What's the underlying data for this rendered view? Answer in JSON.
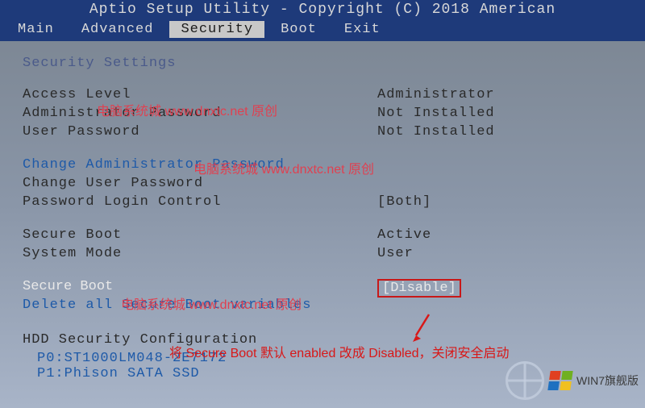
{
  "title": "Aptio Setup Utility - Copyright (C) 2018 American",
  "menu": {
    "items": [
      "Main",
      "Advanced",
      "Security",
      "Boot",
      "Exit"
    ],
    "active": "Security"
  },
  "section_title": "Security Settings",
  "rows": {
    "access_level": {
      "label": "Access Level",
      "value": "Administrator"
    },
    "admin_password": {
      "label": "Administrator Password",
      "value": "Not Installed"
    },
    "user_password": {
      "label": "User Password",
      "value": "Not Installed"
    },
    "change_admin": "Change Administrator Password",
    "change_user": {
      "label": "Change User Password"
    },
    "login_control": {
      "label": "Password Login Control",
      "value": "[Both]"
    },
    "secure_boot_status": {
      "label": "Secure Boot",
      "value": "Active"
    },
    "system_mode": {
      "label": "System Mode",
      "value": "User"
    },
    "secure_boot": {
      "label": "Secure Boot",
      "value": "[Disable]"
    },
    "delete_sb": "Delete all Secure Boot variables"
  },
  "hdd": {
    "title": "HDD Security Configuration",
    "items": [
      "P0:ST1000LM048-2E7172",
      "P1:Phison SATA SSD"
    ]
  },
  "watermarks": {
    "wm1": "电脑系统城 www.dnxtc.net 原创",
    "wm2": "电脑系统城 www.dnxtc.net 原创",
    "wm3": "电脑系统城 www.dnxtc.net 原创"
  },
  "annotation": "将 Secure Boot 默认 enabled 改成 Disabled，关闭安全启动",
  "logo_text": "WIN7旗舰版"
}
